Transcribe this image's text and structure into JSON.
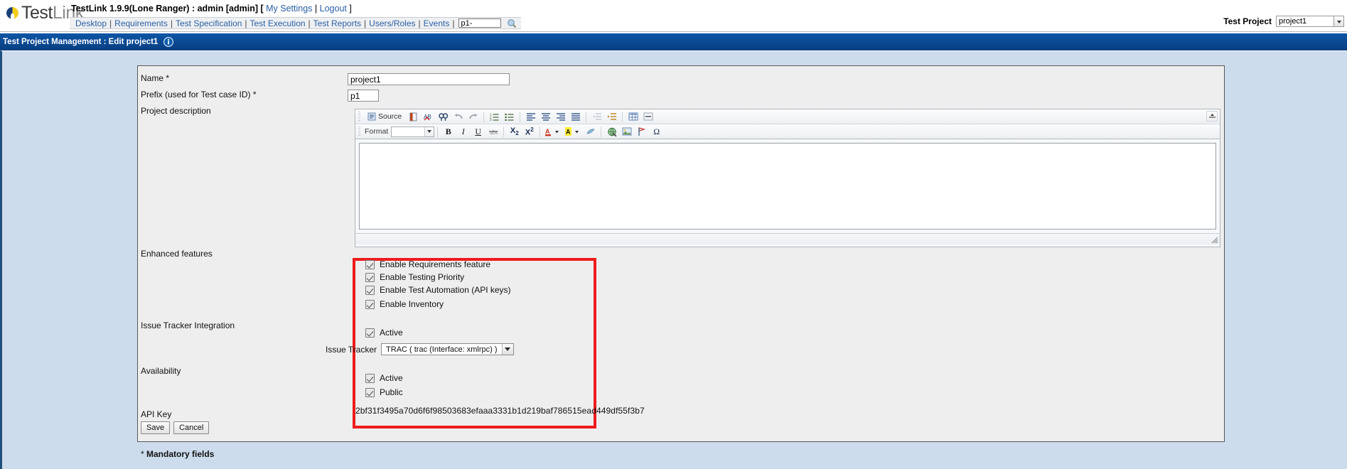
{
  "header": {
    "logo_text_1": "Test",
    "logo_text_2": "Link",
    "logo_icon": "leaf-icon",
    "user_line_prefix": "TestLink 1.9.9(Lone Ranger) : admin [admin] [",
    "my_settings": "My Settings",
    "pipe": "|",
    "logout": "Logout",
    "user_line_suffix": "]",
    "nav": [
      "Desktop",
      "Requirements",
      "Test Specification",
      "Test Execution",
      "Test Reports",
      "Users/Roles",
      "Events"
    ],
    "nav_separator": "|",
    "search_value": "p1-",
    "search_placeholder": "",
    "search_icon": "magnifier-icon",
    "project_label": "Test Project",
    "project_value": "project1",
    "project_dropdown_icon": "chevron-down-icon"
  },
  "titlebar": {
    "title": "Test Project Management : Edit project1",
    "info_icon": "info-icon"
  },
  "form": {
    "name_label": "Name",
    "name_required": "*",
    "name_value": "project1",
    "prefix_label": "Prefix (used for Test case ID)",
    "prefix_required": "*",
    "prefix_value": "p1",
    "description_label": "Project description",
    "description_value": "",
    "enhanced_features_label": "Enhanced features",
    "issue_tracker_label": "Issue Tracker Integration",
    "availability_label": "Availability",
    "api_key_label": "API Key",
    "api_key_value": "2bf31f3495a70d6f6f98503683efaaa3331b1d219baf786515ead449df55f3b7",
    "save_label": "Save",
    "cancel_label": "Cancel",
    "mandatory_star": "*",
    "mandatory_text": " Mandatory fields"
  },
  "editor": {
    "source_label": "Source",
    "format_label": "Format",
    "format_value": "",
    "toolbar_row1": [
      {
        "name": "source-button",
        "glyph": "▤",
        "label": "Source"
      },
      {
        "name": "templates-button",
        "glyph": "▥",
        "label": ""
      },
      {
        "name": "spellcheck-button",
        "glyph": "✓",
        "label": ""
      },
      {
        "name": "find-replace-button",
        "glyph": "⚲",
        "label": ""
      },
      {
        "name": "undo-button",
        "glyph": "↶",
        "label": ""
      },
      {
        "name": "redo-button",
        "glyph": "↷",
        "label": ""
      },
      {
        "name": "numbered-list-button",
        "glyph": "≡",
        "label": ""
      },
      {
        "name": "bulleted-list-button",
        "glyph": "☰",
        "label": ""
      },
      {
        "name": "align-left-button",
        "glyph": "≡",
        "label": ""
      },
      {
        "name": "align-center-button",
        "glyph": "≡",
        "label": ""
      },
      {
        "name": "align-right-button",
        "glyph": "≡",
        "label": ""
      },
      {
        "name": "align-justify-button",
        "glyph": "≡",
        "label": ""
      },
      {
        "name": "outdent-button",
        "glyph": "←",
        "label": ""
      },
      {
        "name": "indent-button",
        "glyph": "→",
        "label": ""
      },
      {
        "name": "insert-table-button",
        "glyph": "▦",
        "label": ""
      },
      {
        "name": "horizontal-rule-button",
        "glyph": "▬",
        "label": ""
      }
    ],
    "toolbar_row2": [
      {
        "name": "bold-button",
        "glyph": "B",
        "label": ""
      },
      {
        "name": "italic-button",
        "glyph": "I",
        "label": ""
      },
      {
        "name": "underline-button",
        "glyph": "U",
        "label": ""
      },
      {
        "name": "strikethrough-button",
        "glyph": "S",
        "label": ""
      },
      {
        "name": "subscript-button",
        "glyph": "X₂",
        "label": ""
      },
      {
        "name": "superscript-button",
        "glyph": "X²",
        "label": ""
      },
      {
        "name": "text-color-button",
        "glyph": "A",
        "label": ""
      },
      {
        "name": "background-color-button",
        "glyph": "A",
        "label": ""
      },
      {
        "name": "remove-format-button",
        "glyph": "⊘",
        "label": ""
      },
      {
        "name": "link-button",
        "glyph": "ἱ0",
        "label": ""
      },
      {
        "name": "image-button",
        "glyph": "▣",
        "label": ""
      },
      {
        "name": "anchor-button",
        "glyph": "⚑",
        "label": ""
      },
      {
        "name": "special-char-button",
        "glyph": "Ω",
        "label": ""
      }
    ],
    "collapse_toolbar_icon": "collapse-toolbar-icon",
    "resize_handle_icon": "resize-handle-icon"
  },
  "enhanced_features": [
    {
      "label": "Enable Requirements feature",
      "checked": true,
      "name": "enable-requirements-checkbox"
    },
    {
      "label": "Enable Testing Priority",
      "checked": true,
      "name": "enable-testing-priority-checkbox"
    },
    {
      "label": "Enable Test Automation (API keys)",
      "checked": true,
      "name": "enable-test-automation-checkbox"
    },
    {
      "label": "Enable Inventory",
      "checked": true,
      "name": "enable-inventory-checkbox"
    }
  ],
  "issue_tracker": {
    "active_label": "Active",
    "active_checked": true,
    "select_label": "Issue Tracker",
    "select_value": "TRAC ( trac (Interface: xmlrpc) )",
    "select_arrow_icon": "chevron-down-icon"
  },
  "availability": [
    {
      "label": "Active",
      "checked": true,
      "name": "availability-active-checkbox"
    },
    {
      "label": "Public",
      "checked": true,
      "name": "availability-public-checkbox"
    }
  ],
  "colors": {
    "title_bar": "#0a4a94",
    "page_background": "#ccdcec",
    "panel_background": "#eeeeee",
    "highlight_box": "#ee1c1c",
    "link": "#2a5fa5",
    "logo_dark": "#3a3a3a",
    "logo_light": "#8a8a8a"
  }
}
